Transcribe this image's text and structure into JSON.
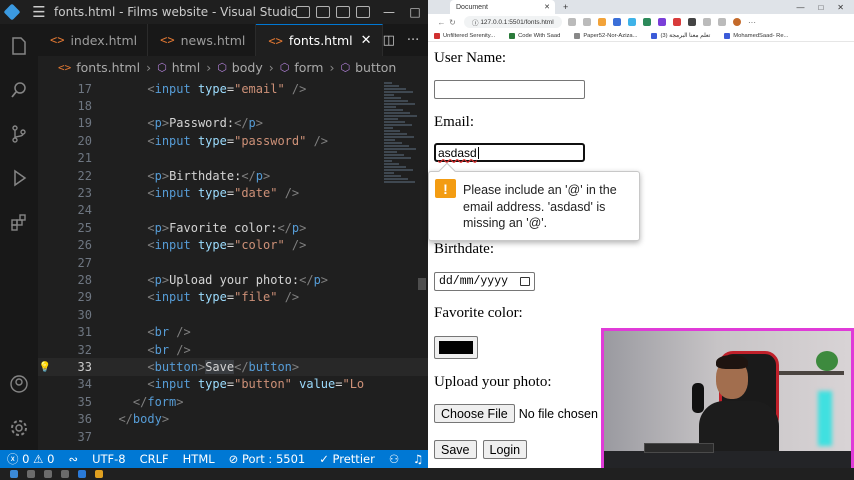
{
  "vscode": {
    "window_title": "fonts.html - Films website - Visual Studio ...",
    "tabs": [
      {
        "label": "index.html",
        "icon": "<>"
      },
      {
        "label": "news.html",
        "icon": "<>"
      },
      {
        "label": "fonts.html",
        "icon": "<>",
        "active": true
      }
    ],
    "breadcrumb": [
      "fonts.html",
      "html",
      "body",
      "form",
      "button"
    ],
    "lines": [
      {
        "n": "17",
        "html": "<span class='t-b'>&lt;</span><span class='t-tag'>input</span> <span class='t-attr'>type</span>=<span class='t-str'>\"email\"</span> <span class='t-b'>/&gt;</span>",
        "indent": 6
      },
      {
        "n": "18",
        "html": "",
        "indent": 0
      },
      {
        "n": "19",
        "html": "<span class='t-b'>&lt;</span><span class='t-tag'>p</span><span class='t-b'>&gt;</span>Password:<span class='t-b'>&lt;/</span><span class='t-tag'>p</span><span class='t-b'>&gt;</span>",
        "indent": 6
      },
      {
        "n": "20",
        "html": "<span class='t-b'>&lt;</span><span class='t-tag'>input</span> <span class='t-attr'>type</span>=<span class='t-str'>\"password\"</span> <span class='t-b'>/&gt;</span>",
        "indent": 6
      },
      {
        "n": "21",
        "html": "",
        "indent": 0
      },
      {
        "n": "22",
        "html": "<span class='t-b'>&lt;</span><span class='t-tag'>p</span><span class='t-b'>&gt;</span>Birthdate:<span class='t-b'>&lt;/</span><span class='t-tag'>p</span><span class='t-b'>&gt;</span>",
        "indent": 6
      },
      {
        "n": "23",
        "html": "<span class='t-b'>&lt;</span><span class='t-tag'>input</span> <span class='t-attr'>type</span>=<span class='t-str'>\"date\"</span> <span class='t-b'>/&gt;</span>",
        "indent": 6
      },
      {
        "n": "24",
        "html": "",
        "indent": 0
      },
      {
        "n": "25",
        "html": "<span class='t-b'>&lt;</span><span class='t-tag'>p</span><span class='t-b'>&gt;</span>Favorite color:<span class='t-b'>&lt;/</span><span class='t-tag'>p</span><span class='t-b'>&gt;</span>",
        "indent": 6
      },
      {
        "n": "26",
        "html": "<span class='t-b'>&lt;</span><span class='t-tag'>input</span> <span class='t-attr'>type</span>=<span class='t-str'>\"color\"</span> <span class='t-b'>/&gt;</span>",
        "indent": 6
      },
      {
        "n": "27",
        "html": "",
        "indent": 0
      },
      {
        "n": "28",
        "html": "<span class='t-b'>&lt;</span><span class='t-tag'>p</span><span class='t-b'>&gt;</span>Upload your photo:<span class='t-b'>&lt;/</span><span class='t-tag'>p</span><span class='t-b'>&gt;</span>",
        "indent": 6
      },
      {
        "n": "29",
        "html": "<span class='t-b'>&lt;</span><span class='t-tag'>input</span> <span class='t-attr'>type</span>=<span class='t-str'>\"file\"</span> <span class='t-b'>/&gt;</span>",
        "indent": 6
      },
      {
        "n": "30",
        "html": "",
        "indent": 0
      },
      {
        "n": "31",
        "html": "<span class='t-b'>&lt;</span><span class='t-tag'>br</span> <span class='t-b'>/&gt;</span>",
        "indent": 6
      },
      {
        "n": "32",
        "html": "<span class='t-b'>&lt;</span><span class='t-tag'>br</span> <span class='t-b'>/&gt;</span>",
        "indent": 6
      },
      {
        "n": "33",
        "html": "<span class='t-b'>&lt;</span><span class='t-tag'>button</span><span class='t-b'>&gt;</span><span class='sel'>Save</span><span class='t-b'>&lt;/</span><span class='t-tag'>button</span><span class='t-b'>&gt;</span>",
        "indent": 6,
        "current": true,
        "bulb": true
      },
      {
        "n": "34",
        "html": "<span class='t-b'>&lt;</span><span class='t-tag'>input</span> <span class='t-attr'>type</span>=<span class='t-str'>\"button\"</span> <span class='t-attr'>value</span>=<span class='t-str'>\"Lo</span>",
        "indent": 6
      },
      {
        "n": "35",
        "html": "<span class='t-b'>&lt;/</span><span class='t-tag'>form</span><span class='t-b'>&gt;</span>",
        "indent": 4
      },
      {
        "n": "36",
        "html": "<span class='t-b'>&lt;/</span><span class='t-tag'>body</span><span class='t-b'>&gt;</span>",
        "indent": 2
      },
      {
        "n": "37",
        "html": "",
        "indent": 0
      }
    ],
    "status": {
      "errors": "0",
      "warnings": "0",
      "encoding": "UTF-8",
      "eol": "CRLF",
      "language": "HTML",
      "port": "Port : 5501",
      "formatter": "Prettier"
    }
  },
  "browser": {
    "tab_title": "Document",
    "url": "127.0.0.1:5501/fonts.html",
    "bookmarks": [
      "Unfiltered Serenity...",
      "Code With Saad",
      "Paper52-Nor-Aziza...",
      "تعلم معنا البرمجة (3)",
      "MohamedSaad- Re..."
    ],
    "form": {
      "user_name_label": "User Name:",
      "email_label": "Email:",
      "email_value": "asdasd",
      "birthdate_label": "Birthdate:",
      "date_placeholder": "dd/mm/yyyy",
      "color_label": "Favorite color:",
      "color_value": "#000000",
      "photo_label": "Upload your photo:",
      "choose_file": "Choose File",
      "no_file": "No file chosen",
      "save": "Save",
      "login": "Login"
    },
    "validation_tooltip": "Please include an '@' in the email address. 'asdasd' is missing an '@'."
  },
  "colors": {
    "status_bar": "#0078d4",
    "webcam_border": "#e03bd8",
    "warning": "#f39c12"
  }
}
